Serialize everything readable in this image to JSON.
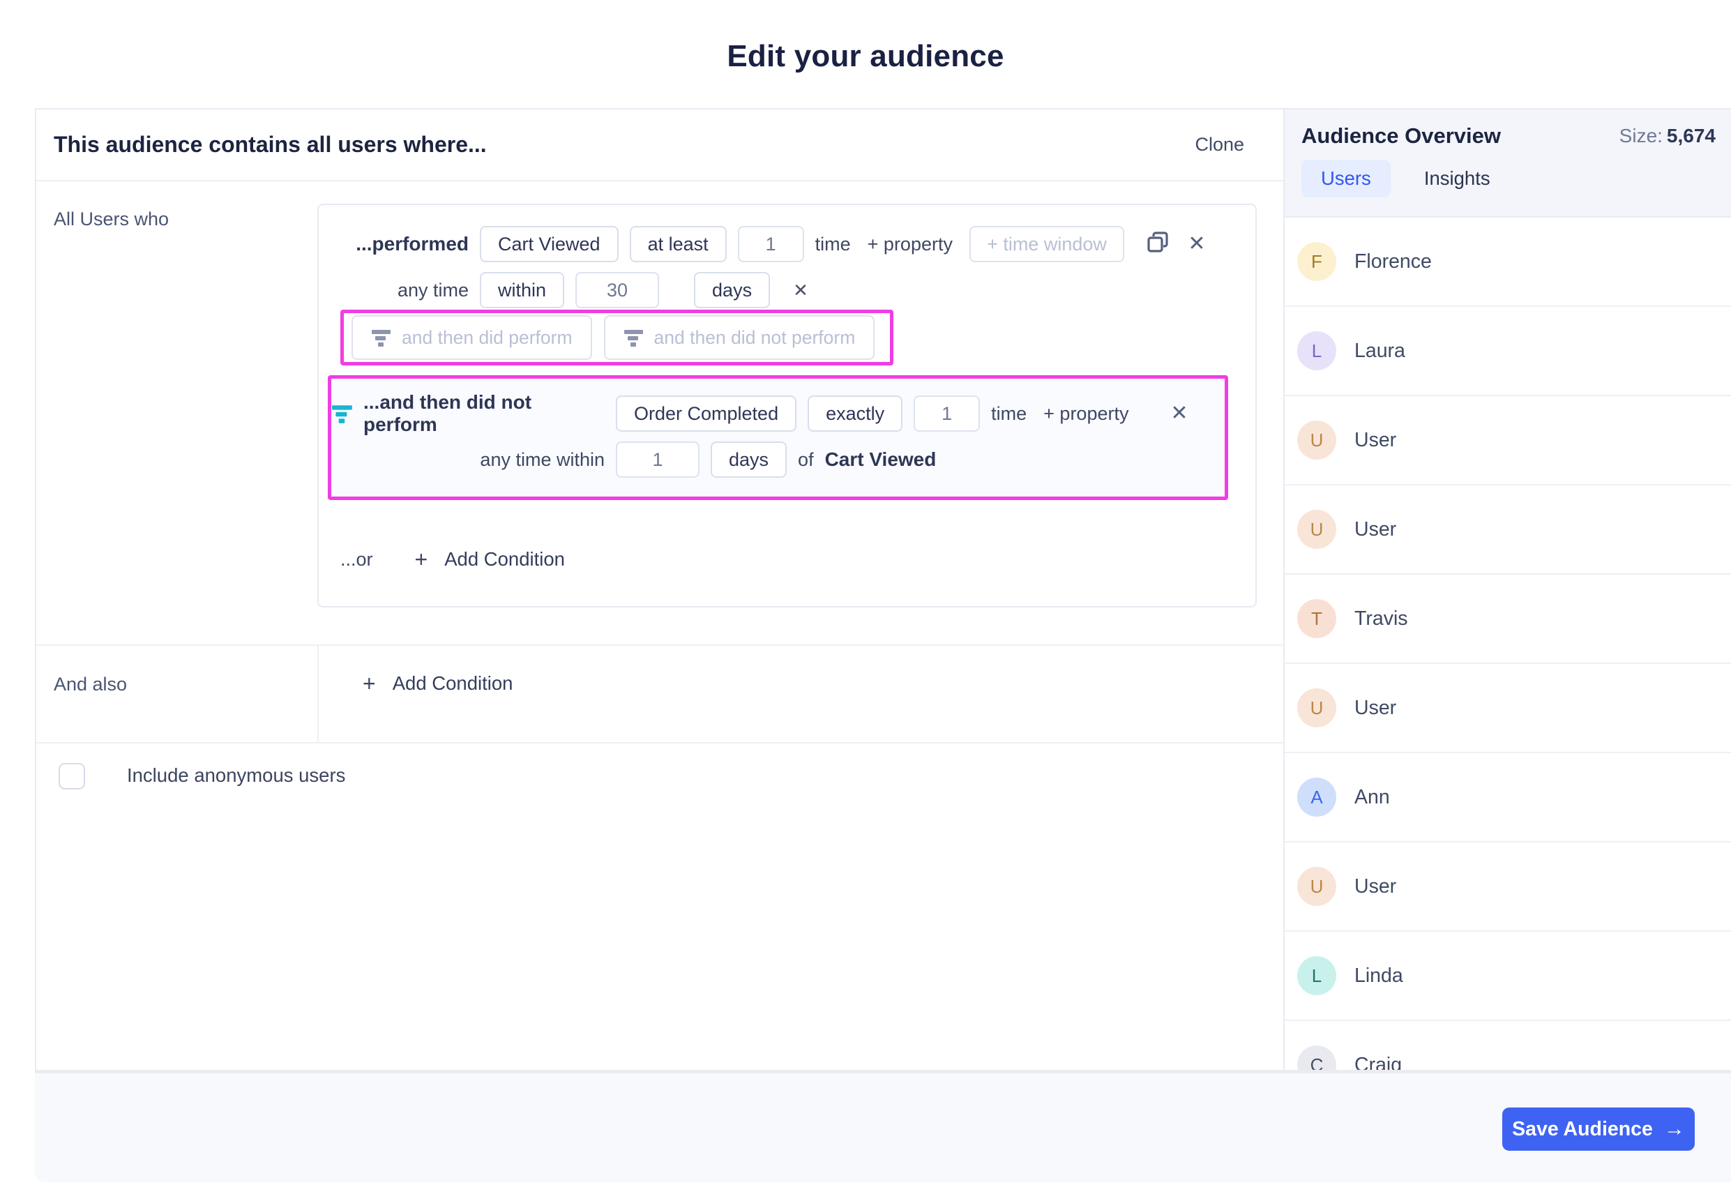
{
  "title": "Edit your audience",
  "editor": {
    "header": {
      "title": "This audience contains all users where...",
      "clone": "Clone"
    },
    "all_users": {
      "label": "All Users who",
      "performed": {
        "label": "...performed",
        "event": "Cart Viewed",
        "operator": "at least",
        "count": "1",
        "count_suffix": "time",
        "add_property": "+ property",
        "time_window_placeholder": "+ time window"
      },
      "time_row": {
        "label": "any time",
        "comparator": "within",
        "value": "30",
        "unit": "days"
      },
      "sequence_suggestions": {
        "did_perform": "and then did perform",
        "did_not_perform": "and then did not perform"
      },
      "sub_condition": {
        "label": "...and then did not perform",
        "event": "Order Completed",
        "operator": "exactly",
        "count": "1",
        "count_suffix": "time",
        "add_property": "+ property",
        "time_row": {
          "label": "any time within",
          "value": "1",
          "unit": "days",
          "of": "of",
          "reference_event": "Cart Viewed"
        }
      },
      "or_label": "...or",
      "add_condition": "Add Condition"
    },
    "and_also": {
      "label": "And also",
      "add_condition": "Add Condition"
    },
    "include_anonymous": "Include anonymous users"
  },
  "sidebar": {
    "title": "Audience Overview",
    "size_label": "Size:",
    "size_value": "5,674",
    "tabs": [
      {
        "label": "Users"
      },
      {
        "label": "Insights"
      }
    ],
    "users": [
      {
        "name": "Florence",
        "initial": "F",
        "bg": "#fdf0cf",
        "fg": "#a07c28"
      },
      {
        "name": "Laura",
        "initial": "L",
        "bg": "#e7e1f9",
        "fg": "#7665c8"
      },
      {
        "name": "User",
        "initial": "U",
        "bg": "#f9e4d8",
        "fg": "#bb8747"
      },
      {
        "name": "User",
        "initial": "U",
        "bg": "#f9e4d8",
        "fg": "#bb8747"
      },
      {
        "name": "Travis",
        "initial": "T",
        "bg": "#f9e0d4",
        "fg": "#a9763d"
      },
      {
        "name": "User",
        "initial": "U",
        "bg": "#f9e4d8",
        "fg": "#bb8747"
      },
      {
        "name": "Ann",
        "initial": "A",
        "bg": "#cfdefb",
        "fg": "#3b68ee"
      },
      {
        "name": "User",
        "initial": "U",
        "bg": "#f9e4d8",
        "fg": "#bb8747"
      },
      {
        "name": "Linda",
        "initial": "L",
        "bg": "#c9f1ec",
        "fg": "#2b6f68"
      },
      {
        "name": "Craig",
        "initial": "C",
        "bg": "#e8eaef",
        "fg": "#454e63"
      }
    ]
  },
  "footer": {
    "save": "Save Audience",
    "save_arrow": "→"
  },
  "icons": {
    "close": "✕",
    "plus": "+"
  },
  "colors": {
    "highlight_magenta": "#f13de4",
    "accent_blue": "#3e63f3",
    "filter_cyan": "#17b6d2"
  }
}
